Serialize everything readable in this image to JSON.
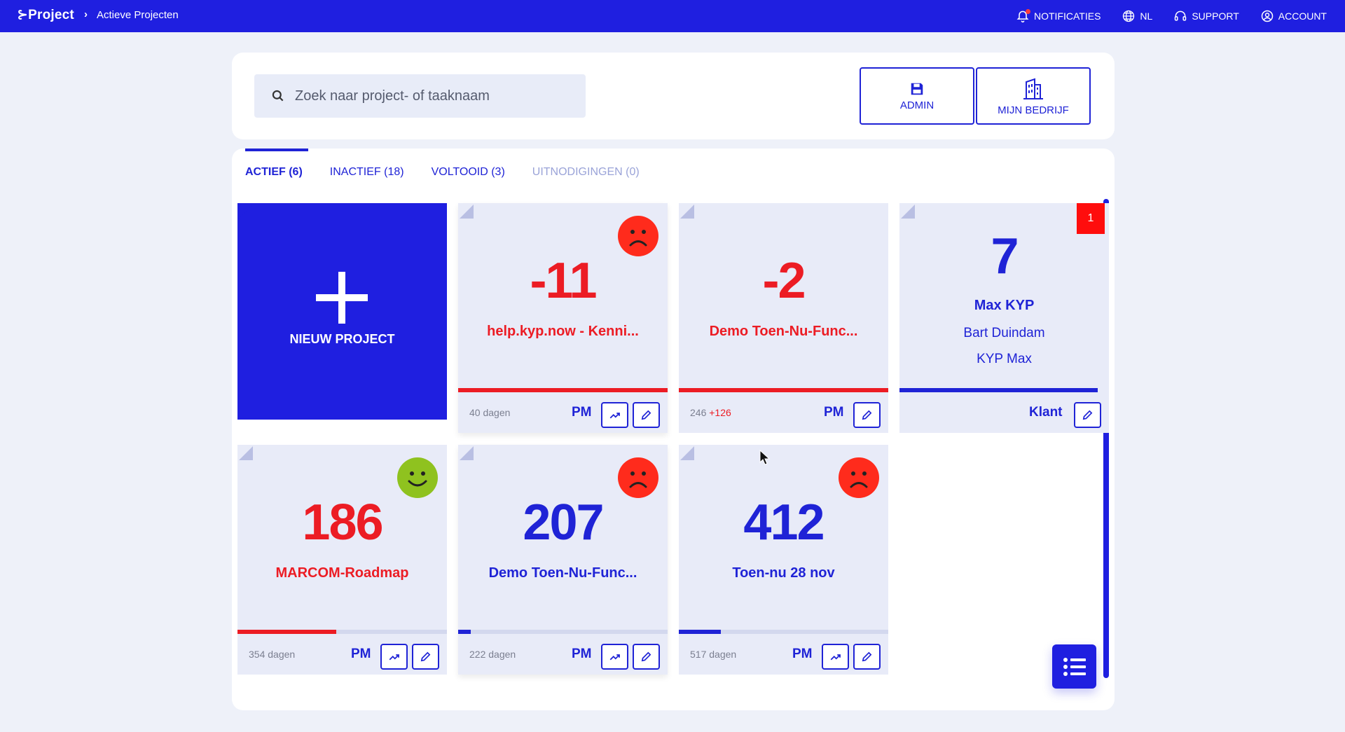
{
  "topbar": {
    "brand": "⊱Project",
    "breadcrumb_sep": "›",
    "breadcrumb": "Actieve Projecten",
    "nav": [
      {
        "label": "NOTIFICATIES",
        "icon": "bell-icon"
      },
      {
        "label": "NL",
        "icon": "globe-icon"
      },
      {
        "label": "SUPPORT",
        "icon": "headset-icon"
      },
      {
        "label": "ACCOUNT",
        "icon": "user-circle-icon"
      }
    ]
  },
  "search": {
    "placeholder": "Zoek naar project- of taaknaam"
  },
  "header_buttons": {
    "admin": "ADMIN",
    "company": "MIJN BEDRIJF"
  },
  "tabs": [
    {
      "label": "ACTIEF (6)",
      "state": "active"
    },
    {
      "label": "INACTIEF (18)",
      "state": "normal"
    },
    {
      "label": "VOLTOOID (3)",
      "state": "normal"
    },
    {
      "label": "UITNODIGINGEN (0)",
      "state": "muted"
    }
  ],
  "new_project": {
    "label": "NIEUW PROJECT"
  },
  "cards": [
    {
      "number": "-11",
      "title": "help.kyp.now - Kenni...",
      "days": "40 dagen",
      "role": "PM",
      "mood": "sad",
      "color": "#ec1c24",
      "progress": 1.0
    },
    {
      "number": "-2",
      "title": "Demo Toen-Nu-Func...",
      "days": "246",
      "days_extra": "+126",
      "role": "PM",
      "color": "#ec1c24",
      "progress": 1.0
    },
    {
      "number": "7",
      "title": "Max KYP",
      "lines": [
        "Bart Duindam",
        "KYP Max"
      ],
      "role": "Klant",
      "badge": "1",
      "color": "#1f23d6",
      "progress": 1.0
    },
    {
      "number": "186",
      "title": "MARCOM-Roadmap",
      "days": "354 dagen",
      "role": "PM",
      "mood": "happy",
      "color": "#ec1c24",
      "progress": 0.47
    },
    {
      "number": "207",
      "title": "Demo Toen-Nu-Func...",
      "days": "222 dagen",
      "role": "PM",
      "mood": "sad",
      "color": "#1f23d6",
      "progress": 0.06
    },
    {
      "number": "412",
      "title": "Toen-nu 28 nov",
      "days": "517 dagen",
      "role": "PM",
      "mood": "sad",
      "color": "#1f23d6",
      "progress": 0.2
    }
  ],
  "colors": {
    "brand": "#1f1fe0",
    "negative": "#ec1c24",
    "sad_face": "#ff2b1c",
    "happy_face": "#8fc21f",
    "background": "#eef1f9"
  }
}
